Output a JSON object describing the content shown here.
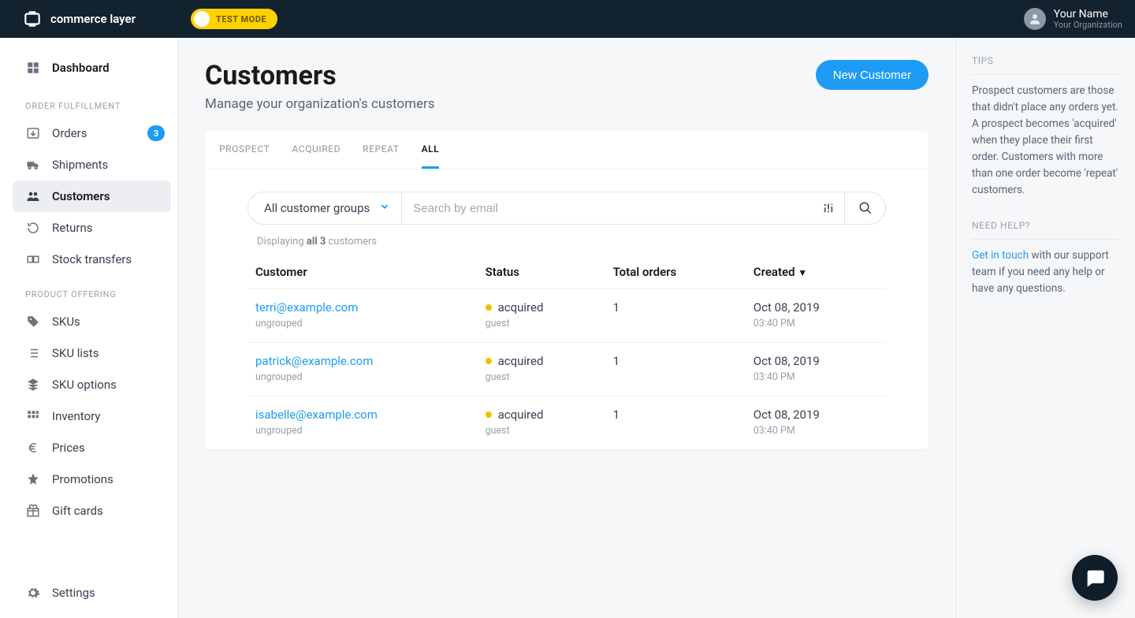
{
  "header": {
    "brand": "commerce layer",
    "test_mode": "TEST MODE",
    "user_name": "Your Name",
    "user_org": "Your Organization"
  },
  "sidebar": {
    "dashboard": "Dashboard",
    "section_fulfillment": "ORDER FULFILLMENT",
    "orders": "Orders",
    "orders_badge": "3",
    "shipments": "Shipments",
    "customers": "Customers",
    "returns": "Returns",
    "stock_transfers": "Stock transfers",
    "section_product": "PRODUCT OFFERING",
    "skus": "SKUs",
    "sku_lists": "SKU lists",
    "sku_options": "SKU options",
    "inventory": "Inventory",
    "prices": "Prices",
    "promotions": "Promotions",
    "gift_cards": "Gift cards",
    "settings": "Settings"
  },
  "page": {
    "title": "Customers",
    "subtitle": "Manage your organization's customers",
    "new_button": "New Customer"
  },
  "tabs": {
    "prospect": "PROSPECT",
    "acquired": "ACQUIRED",
    "repeat": "REPEAT",
    "all": "ALL"
  },
  "filters": {
    "group_select": "All customer groups",
    "search_placeholder": "Search by email"
  },
  "results": {
    "prefix": "Displaying ",
    "bold": "all 3",
    "suffix": " customers"
  },
  "columns": {
    "customer": "Customer",
    "status": "Status",
    "orders": "Total orders",
    "created": "Created",
    "sort_indicator": "▼"
  },
  "rows": [
    {
      "email": "terri@example.com",
      "group": "ungrouped",
      "status": "acquired",
      "role": "guest",
      "orders": "1",
      "date": "Oct 08, 2019",
      "time": "03:40 PM"
    },
    {
      "email": "patrick@example.com",
      "group": "ungrouped",
      "status": "acquired",
      "role": "guest",
      "orders": "1",
      "date": "Oct 08, 2019",
      "time": "03:40 PM"
    },
    {
      "email": "isabelle@example.com",
      "group": "ungrouped",
      "status": "acquired",
      "role": "guest",
      "orders": "1",
      "date": "Oct 08, 2019",
      "time": "03:40 PM"
    }
  ],
  "right": {
    "tips_heading": "TIPS",
    "tips_text": "Prospect customers are those that didn't place any orders yet. A prospect becomes 'acquired' when they place their first order. Customers with more than one order become 'repeat' customers.",
    "help_heading": "NEED HELP?",
    "help_link": "Get in touch",
    "help_text": " with our support team if you need any help or have any questions."
  }
}
